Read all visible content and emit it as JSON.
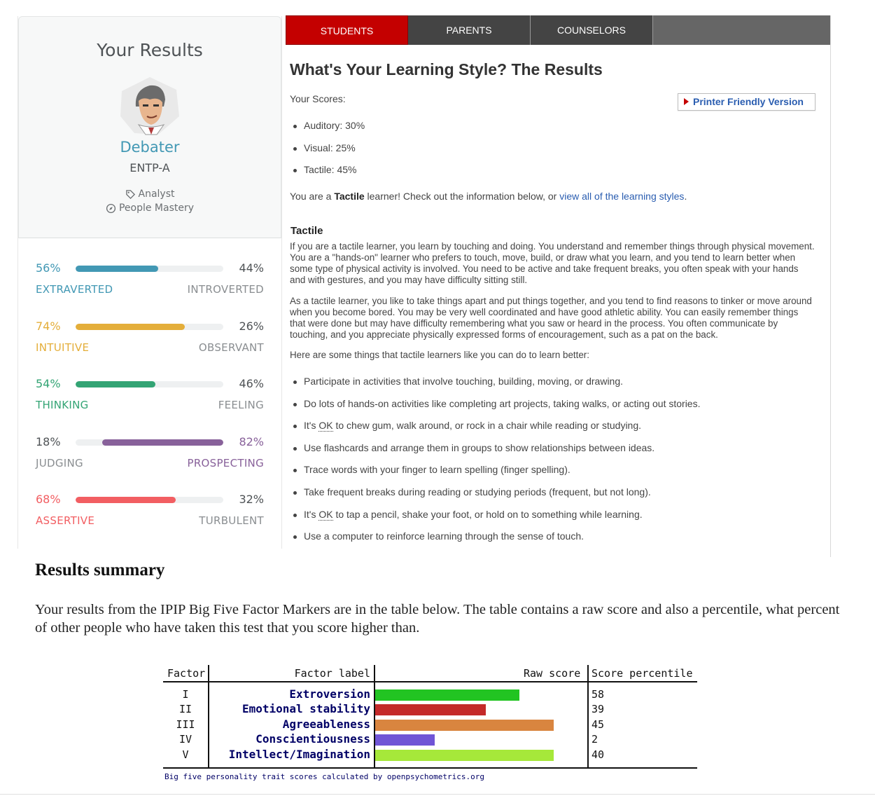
{
  "profile": {
    "heading": "Your Results",
    "type_name": "Debater",
    "type_code": "ENTP-A",
    "role": "Analyst",
    "strategy": "People Mastery"
  },
  "traits": [
    {
      "left_pct": "56%",
      "right_pct": "44%",
      "left_label": "EXTRAVERTED",
      "right_label": "INTROVERTED",
      "fill_side": "left",
      "fill_percent": 56,
      "color": "#4298b4",
      "strong_side": "left"
    },
    {
      "left_pct": "74%",
      "right_pct": "26%",
      "left_label": "INTUITIVE",
      "right_label": "OBSERVANT",
      "fill_side": "left",
      "fill_percent": 74,
      "color": "#e4ae3a",
      "strong_side": "left"
    },
    {
      "left_pct": "54%",
      "right_pct": "46%",
      "left_label": "THINKING",
      "right_label": "FEELING",
      "fill_side": "left",
      "fill_percent": 54,
      "color": "#33a474",
      "strong_side": "left"
    },
    {
      "left_pct": "18%",
      "right_pct": "82%",
      "left_label": "JUDGING",
      "right_label": "PROSPECTING",
      "fill_side": "right",
      "fill_percent": 82,
      "color": "#88619a",
      "strong_side": "right"
    },
    {
      "left_pct": "68%",
      "right_pct": "32%",
      "left_label": "ASSERTIVE",
      "right_label": "TURBULENT",
      "fill_side": "left",
      "fill_percent": 68,
      "color": "#f25e62",
      "strong_side": "left"
    }
  ],
  "learning": {
    "tabs": [
      "STUDENTS",
      "PARENTS",
      "COUNSELORS"
    ],
    "active_tab": 0,
    "title": "What's Your Learning Style? The Results",
    "scores_label": "Your Scores:",
    "printer_label": "Printer Friendly Version",
    "scores": [
      "Auditory: 30%",
      "Visual: 25%",
      "Tactile: 45%"
    ],
    "learner_prefix": "You are a ",
    "learner_type": "Tactile",
    "learner_middle": " learner! Check out the information below, or ",
    "learner_link": "view all of the learning styles",
    "learner_suffix": ".",
    "section_heading": "Tactile",
    "para1": "If you are a tactile learner, you learn by touching and doing. You understand and remember things through physical movement. You are a \"hands-on\" learner who prefers to touch, move, build, or draw what you learn, and you tend to learn better when some type of physical activity is involved. You need to be active and take frequent breaks, you often speak with your hands and with gestures, and you may have difficulty sitting still.",
    "para2": "As a tactile learner, you like to take things apart and put things together, and you tend to find reasons to tinker or move around when you become bored. You may be very well coordinated and have good athletic ability. You can easily remember things that were done but may have difficulty remembering what you saw or heard in the process. You often communicate by touching, and you appreciate physically expressed forms of encouragement, such as a pat on the back.",
    "para3": "Here are some things that tactile learners like you can do to learn better:",
    "tips": [
      "Participate in activities that involve touching, building, moving, or drawing.",
      "Do lots of hands-on activities like completing art projects, taking walks, or acting out stories.",
      [
        "It's ",
        "OK",
        " to chew gum, walk around, or rock in a chair while reading or studying."
      ],
      "Use flashcards and arrange them in groups to show relationships between ideas.",
      "Trace words with your finger to learn spelling (finger spelling).",
      "Take frequent breaks during reading or studying periods (frequent, but not long).",
      [
        "It's ",
        "OK",
        " to tap a pencil, shake your foot, or hold on to something while learning."
      ],
      "Use a computer to reinforce learning through the sense of touch."
    ]
  },
  "summary": {
    "title": "Results summary",
    "text": "Your results from the IPIP Big Five Factor Markers are in the table below. The table contains a raw score and also a percentile, what percent of other people who have taken this test that you score higher than."
  },
  "chart_data": {
    "type": "bar",
    "headers": [
      "Factor",
      "Factor label",
      "Raw score",
      "Score percentile"
    ],
    "factors": [
      "I",
      "II",
      "III",
      "IV",
      "V"
    ],
    "categories": [
      "Extroversion",
      "Emotional stability",
      "Agreeableness",
      "Conscientiousness",
      "Intellect/Imagination"
    ],
    "values": [
      34,
      26,
      42,
      14,
      42
    ],
    "raw_score_max": 50,
    "percentiles": [
      58,
      39,
      45,
      2,
      40
    ],
    "colors": [
      "#22c422",
      "#c42a2a",
      "#d9853f",
      "#7055d6",
      "#a6e83a"
    ],
    "footnote": "Big five personality trait scores calculated by openpsychometrics.org"
  }
}
